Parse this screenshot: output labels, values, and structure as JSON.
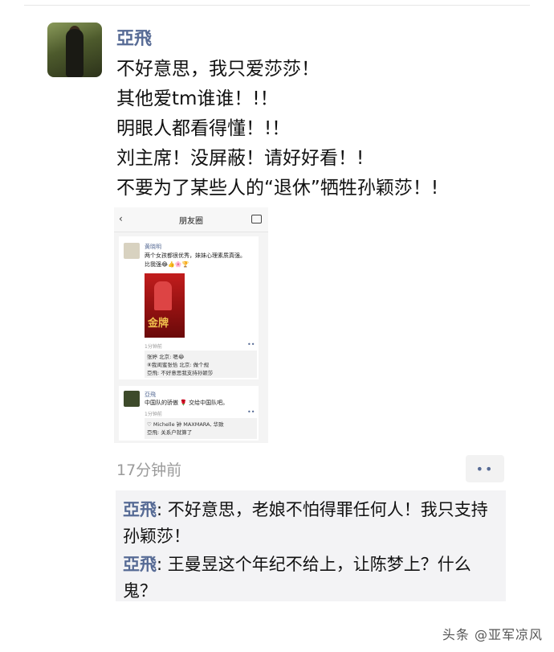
{
  "post": {
    "username": "亞飛",
    "lines": [
      "不好意思，我只爱莎莎！",
      "其他爱tm谁谁！!！",
      "明眼人都看得懂！!！",
      "刘主席！没屏蔽！请好好看！!",
      "不要为了某些人的“退休”牺牲孙颖莎！!"
    ],
    "time": "17分钟前"
  },
  "embedded": {
    "back": "‹",
    "title": "朋友圈",
    "post1": {
      "name": "黄晓明",
      "text1": "两个女孩都很优秀，妹妹心理素质真强。",
      "text2": "比我强😂👍🌸🏆",
      "poster_text": "金牌",
      "time": "1分钟前",
      "dots": "••",
      "comments": [
        "张婷 北京: 嗯😂",
        "⑧我闺蜜张恰 北京: 做个规",
        "亞飛: 不好意思我支持孙颖莎"
      ]
    },
    "post2": {
      "name": "亞飛",
      "text": "中国队的骄傲 🌹 交给中国队吧。",
      "time": "1分钟前",
      "dots": "••",
      "comments": [
        "♡ Michelle 钟 MAXMARA, 华致",
        "亞飛: 关系户就算了"
      ]
    }
  },
  "actions": {
    "more": "••"
  },
  "comments": [
    {
      "name": "亞飛",
      "sep": ": ",
      "text": "不好意思，老娘不怕得罪任何人！我只支持孙颖莎！"
    },
    {
      "name": "亞飛",
      "sep": ": ",
      "text": "王曼昱这个年纪不给上，让陈梦上？什么鬼？"
    }
  ],
  "watermark": "头条 @亚军凉风"
}
